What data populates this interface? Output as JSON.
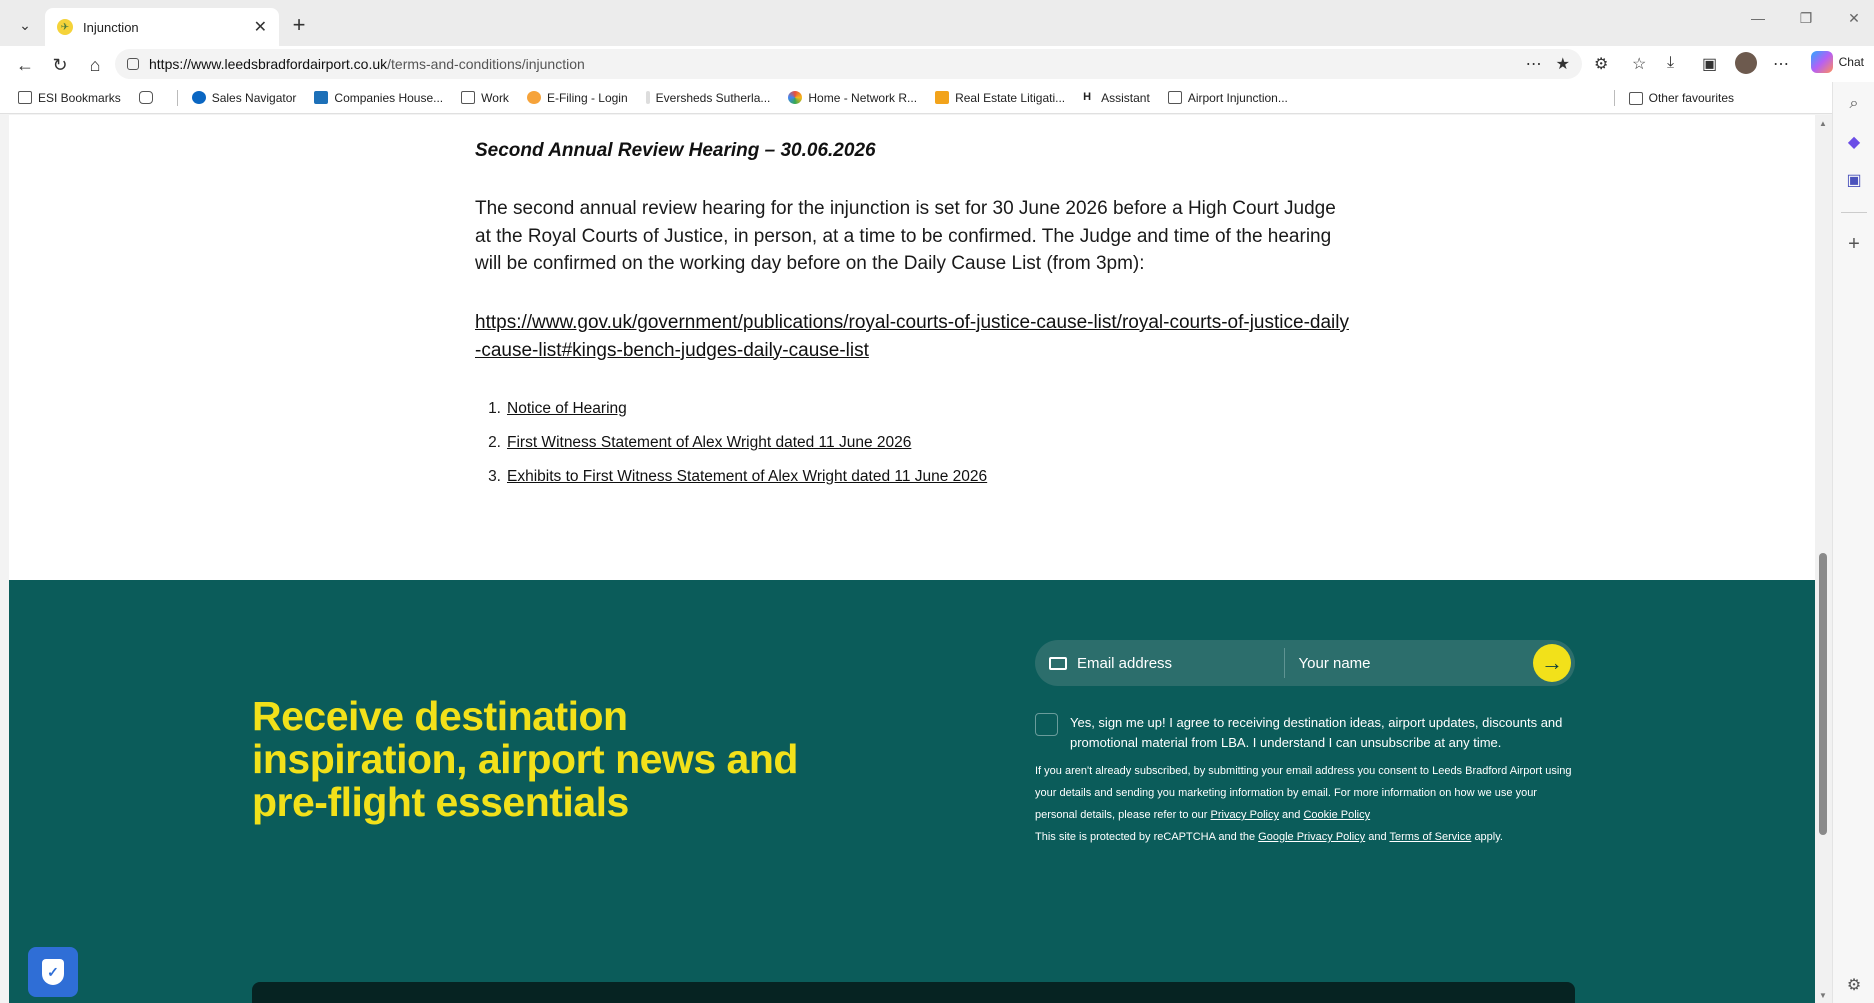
{
  "browser": {
    "tab_title": "Injunction",
    "url_domain": "https://www.leedsbradfordairport.co.uk",
    "url_path": "/terms-and-conditions/injunction",
    "chat_label": "Chat",
    "bookmarks": [
      {
        "label": "ESI Bookmarks",
        "icon": "bookmark-folder-icon"
      },
      {
        "label": "",
        "icon": "device-icon"
      },
      {
        "label": "Sales Navigator",
        "icon": "compass-icon"
      },
      {
        "label": "Companies House...",
        "icon": "crown-icon"
      },
      {
        "label": "Work",
        "icon": "folder-icon"
      },
      {
        "label": "E-Filing - Login",
        "icon": "efiling-icon"
      },
      {
        "label": "Eversheds Sutherla...",
        "icon": "page-icon"
      },
      {
        "label": "Home - Network R...",
        "icon": "network-icon"
      },
      {
        "label": "Real Estate Litigati...",
        "icon": "grid-icon"
      },
      {
        "label": "Assistant",
        "icon": "h-icon"
      },
      {
        "label": "Airport Injunction...",
        "icon": "folder-icon"
      }
    ],
    "other_favourites": "Other favourites"
  },
  "page": {
    "hearing_title": "Second Annual Review Hearing – 30.06.2026",
    "hearing_para": "The second annual review hearing for the injunction is set for 30 June 2026 before a High Court Judge at the Royal Courts of Justice, in person, at a time to be confirmed. The Judge and time of the hearing will be confirmed on the working day before on the Daily Cause List (from 3pm):",
    "cause_link": "https://www.gov.uk/government/publications/royal-courts-of-justice-cause-list/royal-courts-of-justice-daily-cause-list#kings-bench-judges-daily-cause-list",
    "documents": [
      {
        "num": "1.",
        "label": "Notice of Hearing"
      },
      {
        "num": "2.",
        "label": "First Witness Statement of Alex Wright dated 11 June 2026"
      },
      {
        "num": "3.",
        "label": "Exhibits to First Witness Statement of Alex Wright dated 11 June 2026"
      }
    ]
  },
  "newsletter": {
    "heading": "Receive destination inspiration, airport news and pre-flight essentials",
    "email_placeholder": "Email address",
    "name_placeholder": "Your name",
    "consent_text": "Yes, sign me up! I agree to receiving destination ideas, airport updates, discounts and promotional material from LBA. I understand I can unsubscribe at any time.",
    "info_text_1": "If you aren't already subscribed, by submitting your email address you consent to Leeds Bradford Airport using your details and sending you marketing information by email. For more information on how we use your personal details, please refer to our",
    "privacy_policy": "Privacy Policy",
    "and_1": "and",
    "cookie_policy": "Cookie Policy",
    "recaptcha_text": "This site is protected by reCAPTCHA and the",
    "google_privacy": "Google Privacy Policy",
    "and_2": "and",
    "terms_of_service": "Terms of Service",
    "apply": "apply."
  },
  "colors": {
    "footer_bg": "#0b5c5a",
    "accent_yellow": "#f2e11a"
  }
}
